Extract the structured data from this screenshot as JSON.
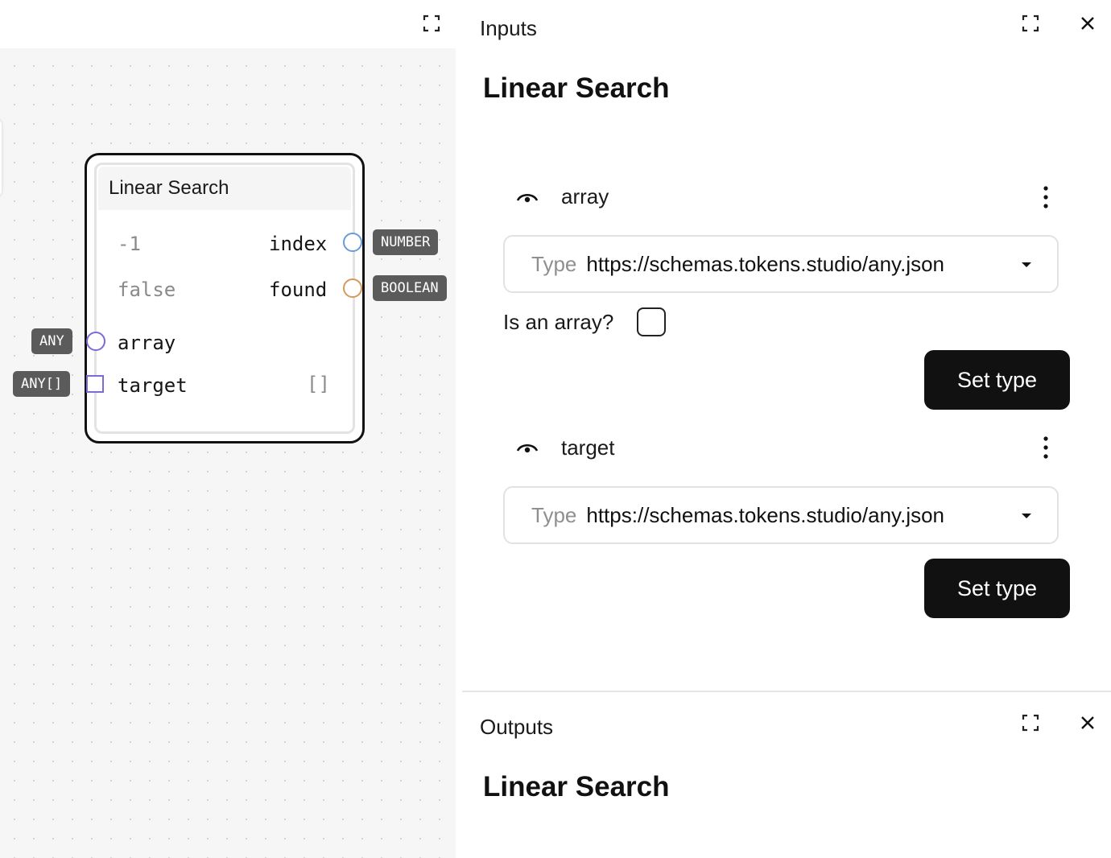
{
  "canvas": {
    "node": {
      "title": "Linear Search",
      "outputs": [
        {
          "value": "-1",
          "name": "index",
          "type": "NUMBER",
          "color": "#6a9bd8"
        },
        {
          "value": "false",
          "name": "found",
          "type": "BOOLEAN",
          "color": "#d49a5a"
        }
      ],
      "inputs": [
        {
          "name": "array",
          "type": "ANY",
          "color": "#7b6ad8",
          "value": ""
        },
        {
          "name": "target",
          "type": "ANY[]",
          "color": "#7b6ad8",
          "value": "[]"
        }
      ]
    },
    "icons": {
      "fullscreen": "fullscreen-icon"
    }
  },
  "inputs_panel": {
    "label": "Inputs",
    "title": "Linear Search",
    "fields": [
      {
        "name": "array",
        "type_label": "Type",
        "type_value": "https://schemas.tokens.studio/any.json",
        "is_array_label": "Is an array?",
        "is_array_checked": false,
        "button": "Set type"
      },
      {
        "name": "target",
        "type_label": "Type",
        "type_value": "https://schemas.tokens.studio/any.json",
        "button": "Set type"
      }
    ]
  },
  "outputs_panel": {
    "label": "Outputs",
    "title": "Linear Search"
  },
  "colors": {
    "accent": "#111111",
    "port_input": "#7b6ad8",
    "port_number": "#6a9bd8",
    "port_boolean": "#d49a5a"
  }
}
